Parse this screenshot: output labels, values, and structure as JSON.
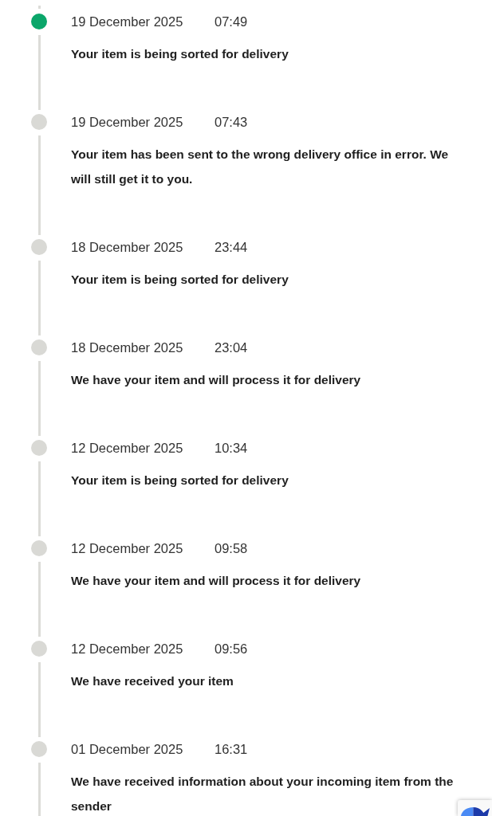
{
  "events": [
    {
      "date": "19 December 2025",
      "time": "07:49",
      "message": "Your item is being sorted for delivery",
      "current": true
    },
    {
      "date": "19 December 2025",
      "time": "07:43",
      "message": "Your item has been sent to the wrong delivery office in error. We will still get it to you.",
      "current": false
    },
    {
      "date": "18 December 2025",
      "time": "23:44",
      "message": "Your item is being sorted for delivery",
      "current": false
    },
    {
      "date": "18 December 2025",
      "time": "23:04",
      "message": "We have your item and will process it for delivery",
      "current": false
    },
    {
      "date": "12 December 2025",
      "time": "10:34",
      "message": "Your item is being sorted for delivery",
      "current": false
    },
    {
      "date": "12 December 2025",
      "time": "09:58",
      "message": "We have your item and will process it for delivery",
      "current": false
    },
    {
      "date": "12 December 2025",
      "time": "09:56",
      "message": "We have received your item",
      "current": false
    },
    {
      "date": "01 December 2025",
      "time": "16:31",
      "message": "We have received information about your incoming item from the sender",
      "current": false
    }
  ]
}
